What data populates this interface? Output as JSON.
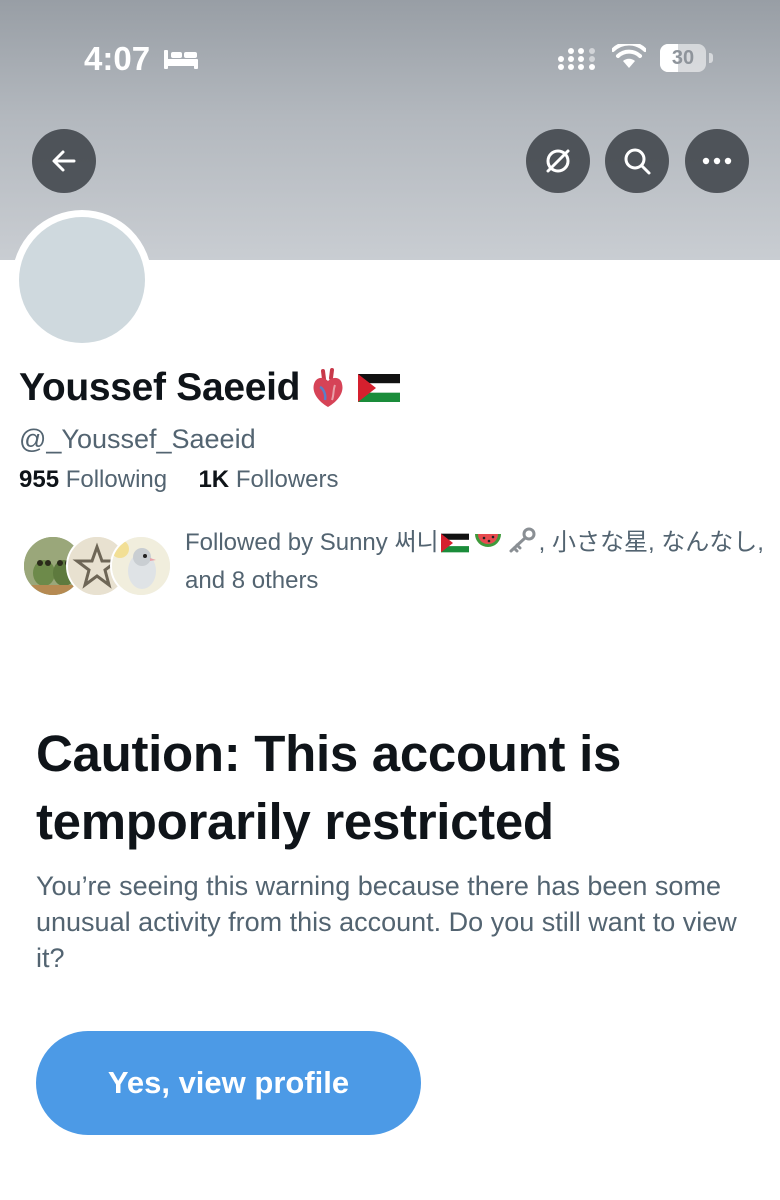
{
  "status_bar": {
    "time": "4:07",
    "battery": "30",
    "icons": [
      "bed-icon",
      "signal-icon",
      "wifi-icon",
      "battery-icon"
    ]
  },
  "header": {
    "buttons": [
      "back-arrow-icon",
      "grok-icon",
      "search-icon",
      "more-icon"
    ],
    "banner_color": "#b3b8be"
  },
  "profile": {
    "display_name": "Youssef Saeeid",
    "name_emoji": [
      "anatomical-heart-icon",
      "palestine-flag-icon"
    ],
    "handle": "@_Youssef_Saeeid",
    "following_count": "955",
    "following_label": "Following",
    "followers_count": "1K",
    "followers_label": "Followers",
    "followed_by_prefix": "Followed by Sunny 써니",
    "followed_by_rest": ", 小さな星, なんなし, and 8 others",
    "followed_by_emoji": [
      "palestine-flag-icon",
      "watermelon-icon",
      "key-icon"
    ]
  },
  "warning": {
    "title": "Caution: This account is temporarily restricted",
    "body": "You’re seeing this warning because there has been some unusual activity from this account. Do you still want to view it?",
    "button_label": "Yes, view profile"
  },
  "colors": {
    "accent": "#4c9ae6",
    "text_primary": "#0f1419",
    "text_secondary": "#536471",
    "avatar_placeholder": "#cfd9de"
  }
}
